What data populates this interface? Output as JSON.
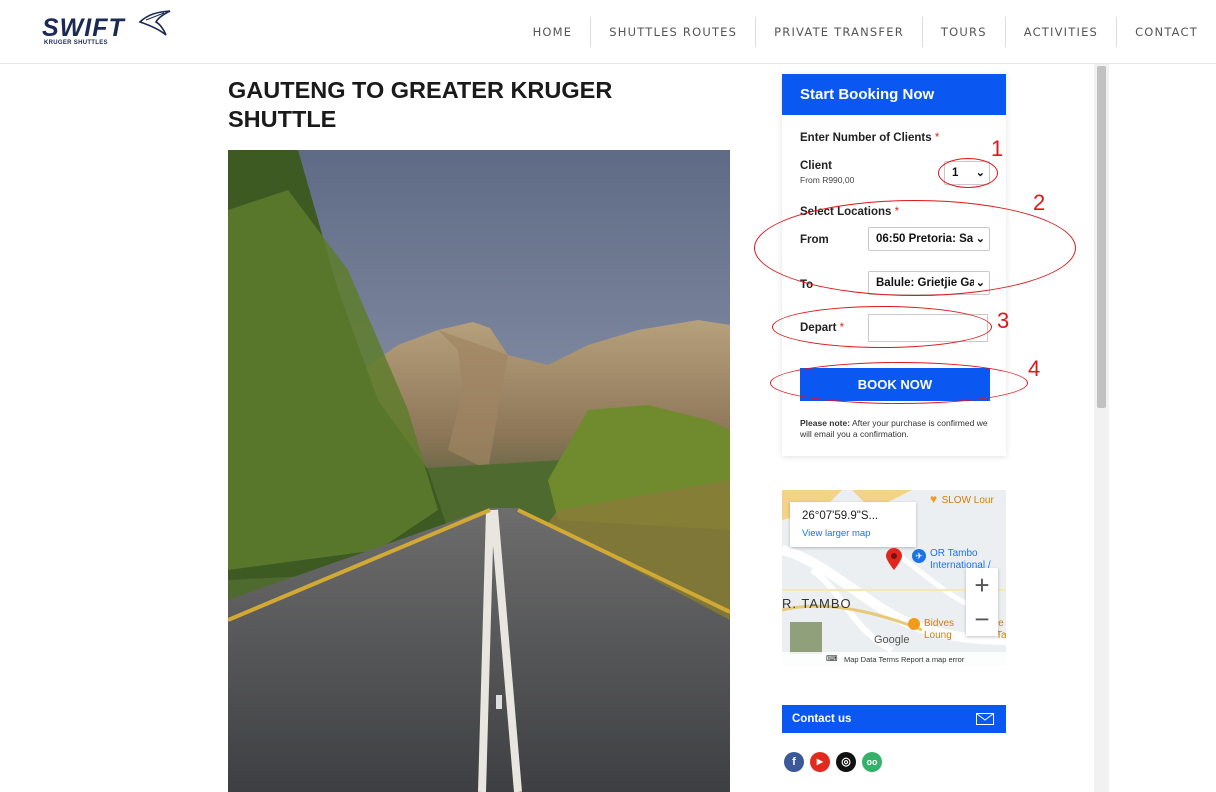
{
  "header": {
    "logo_text": "SWIFT",
    "logo_subtext": "KRUGER SHUTTLES",
    "nav": [
      {
        "label": "HOME"
      },
      {
        "label": "SHUTTLES ROUTES"
      },
      {
        "label": "PRIVATE TRANSFER"
      },
      {
        "label": "TOURS"
      },
      {
        "label": "ACTIVITIES"
      },
      {
        "label": "CONTACT"
      }
    ]
  },
  "main": {
    "title_line1": "GAUTENG TO GREATER KRUGER",
    "title_line2": "SHUTTLE"
  },
  "booking": {
    "heading": "Start Booking Now",
    "clients_label": "Enter Number of Clients",
    "required_mark": "*",
    "client_label": "Client",
    "client_price": "From R990,00",
    "client_count": "1",
    "locations_label": "Select Locations",
    "from_label": "From",
    "from_value": "06:50 Pretoria: Sa",
    "to_label": "To",
    "to_value": "Balule: Grietjie Ga",
    "depart_label": "Depart",
    "depart_value": "",
    "book_button": "BOOK NOW",
    "note_bold": "Please note:",
    "note_text": " After your purchase is confirmed we will email you a confirmation."
  },
  "annotations": [
    "1",
    "2",
    "3",
    "4"
  ],
  "map": {
    "coordinates": "26°07'59.9\"S...",
    "view_larger": "View larger map",
    "poi_1": "SLOW Lour",
    "poi_2": "OR Tambo",
    "poi_2b": "International /",
    "poi_3": "R. TAMBO",
    "poi_4": "Bidves",
    "poi_4b": "Loung",
    "poi_5": "ie",
    "poi_5b": "Ta",
    "brand": "Google",
    "zoom_in": "+",
    "zoom_out": "−",
    "footer": "Map Data   Terms   Report a map error"
  },
  "contact": {
    "label": "Contact us"
  },
  "social": [
    {
      "name": "facebook",
      "glyph": "f",
      "color": "#3b5998"
    },
    {
      "name": "youtube",
      "glyph": "▶",
      "color": "#e02a20"
    },
    {
      "name": "instagram",
      "glyph": "◎",
      "color": "#111111"
    },
    {
      "name": "tripadvisor",
      "glyph": "oo",
      "color": "#34b16a"
    }
  ],
  "colors": {
    "accent": "#0b57f2",
    "annotation": "#e0161a"
  }
}
